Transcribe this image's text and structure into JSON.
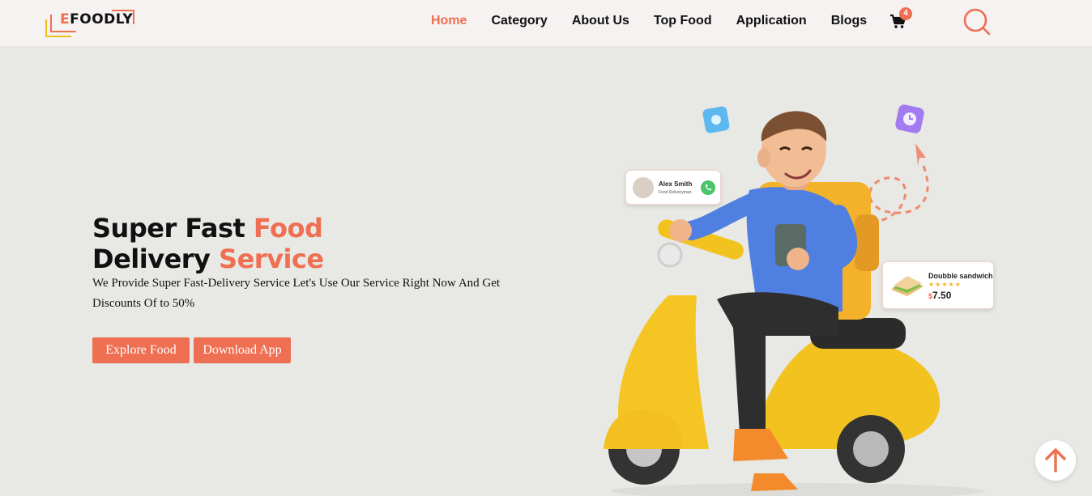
{
  "brand": {
    "logo_first": "E",
    "logo_rest": "FOODLY"
  },
  "nav": {
    "items": [
      {
        "label": "Home",
        "active": true
      },
      {
        "label": "Category"
      },
      {
        "label": "About Us"
      },
      {
        "label": "Top Food"
      },
      {
        "label": "Application"
      },
      {
        "label": "Blogs"
      }
    ],
    "cart_count": "4"
  },
  "hero": {
    "title_line1_a": "Super Fast ",
    "title_line1_b": "Food",
    "title_line2_a": "Delivery ",
    "title_line2_b": "Service",
    "description": "We Provide Super Fast-Delivery Service Let's Use Our Service Right Now And Get Discounts Of to 50%",
    "button_explore": "Explore Food",
    "button_download": "Download App"
  },
  "driver_card": {
    "name": "Alex Smith",
    "role": "Food Deliveryman"
  },
  "food_card": {
    "name": "Doubble sandwich",
    "stars": "★★★★★",
    "currency": "$",
    "price": "7.50"
  },
  "colors": {
    "accent": "#ee6f52",
    "logo_yellow": "#e8c21a",
    "background": "#e8e8e5",
    "header": "#f5f2f1"
  },
  "icons": [
    "cart-icon",
    "search-icon",
    "arrow-up-icon",
    "phone-icon",
    "clock-icon",
    "location-pin-icon"
  ]
}
